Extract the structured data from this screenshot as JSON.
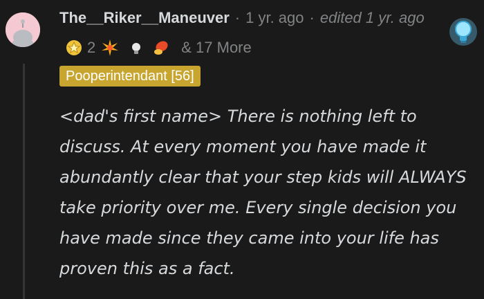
{
  "comment": {
    "username": "The__Riker__Maneuver",
    "age": "1 yr. ago",
    "edited": "edited 1 yr. ago",
    "award_count": "2",
    "more_awards": "& 17 More",
    "flair": "Pooperintendant [56]",
    "body": "<dad's first name> There is nothing left to discuss. At every moment you have made it abundantly clear that your step kids will ALWAYS take priority over me. Every single decision you have made since they came into your life has proven this as a fact."
  },
  "icons": {
    "avatar": "snoo-avatar-icon",
    "award_1": "silver-award-icon",
    "award_2": "sparkle-explosion-award-icon",
    "award_3": "lightbulb-award-icon",
    "award_4": "rocket-like-award-icon",
    "header_award": "helpful-lightbulb-award-icon"
  },
  "colors": {
    "background": "#1a1a1b",
    "text": "#d7dadc",
    "muted": "#818384",
    "flair_bg": "#c8a52e"
  }
}
